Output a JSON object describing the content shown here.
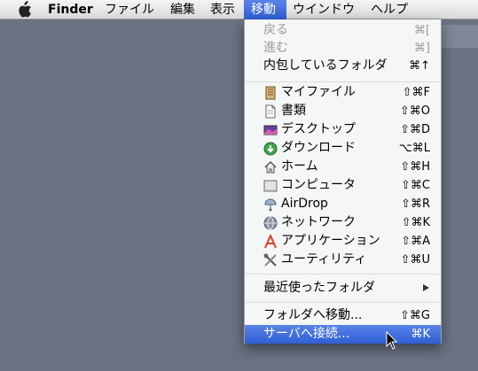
{
  "menubar": {
    "apple_icon": "apple-logo-icon",
    "items": [
      {
        "label": "Finder"
      },
      {
        "label": "ファイル"
      },
      {
        "label": "編集"
      },
      {
        "label": "表示"
      },
      {
        "label": "移動"
      },
      {
        "label": "ウインドウ"
      },
      {
        "label": "ヘルプ"
      }
    ]
  },
  "menu": {
    "items": [
      {
        "label": "戻る",
        "shortcut": "⌘[",
        "enabled": false
      },
      {
        "label": "進む",
        "shortcut": "⌘]",
        "enabled": false
      },
      {
        "label": "内包しているフォルダ",
        "shortcut": "⌘↑",
        "enabled": true
      },
      {
        "label": "マイファイル",
        "shortcut": "⇧⌘F",
        "icon": "all-my-files-icon"
      },
      {
        "label": "書類",
        "shortcut": "⇧⌘O",
        "icon": "documents-icon"
      },
      {
        "label": "デスクトップ",
        "shortcut": "⇧⌘D",
        "icon": "desktop-icon"
      },
      {
        "label": "ダウンロード",
        "shortcut": "⌥⌘L",
        "icon": "downloads-icon"
      },
      {
        "label": "ホーム",
        "shortcut": "⇧⌘H",
        "icon": "home-icon"
      },
      {
        "label": "コンピュータ",
        "shortcut": "⇧⌘C",
        "icon": "computer-icon"
      },
      {
        "label": "AirDrop",
        "shortcut": "⇧⌘R",
        "icon": "airdrop-icon"
      },
      {
        "label": "ネットワーク",
        "shortcut": "⇧⌘K",
        "icon": "network-icon"
      },
      {
        "label": "アプリケーション",
        "shortcut": "⇧⌘A",
        "icon": "applications-icon"
      },
      {
        "label": "ユーティリティ",
        "shortcut": "⇧⌘U",
        "icon": "utilities-icon"
      },
      {
        "label": "最近使ったフォルダ",
        "submenu": true
      },
      {
        "label": "フォルダへ移動...",
        "shortcut": "⇧⌘G"
      },
      {
        "label": "サーバへ接続...",
        "shortcut": "⌘K",
        "highlighted": true
      }
    ]
  },
  "colors": {
    "desktop": "#6a7384",
    "highlight": "#2f5fd6",
    "menubar": "#e8e8e8",
    "disabled_text": "#9c9c9c"
  }
}
